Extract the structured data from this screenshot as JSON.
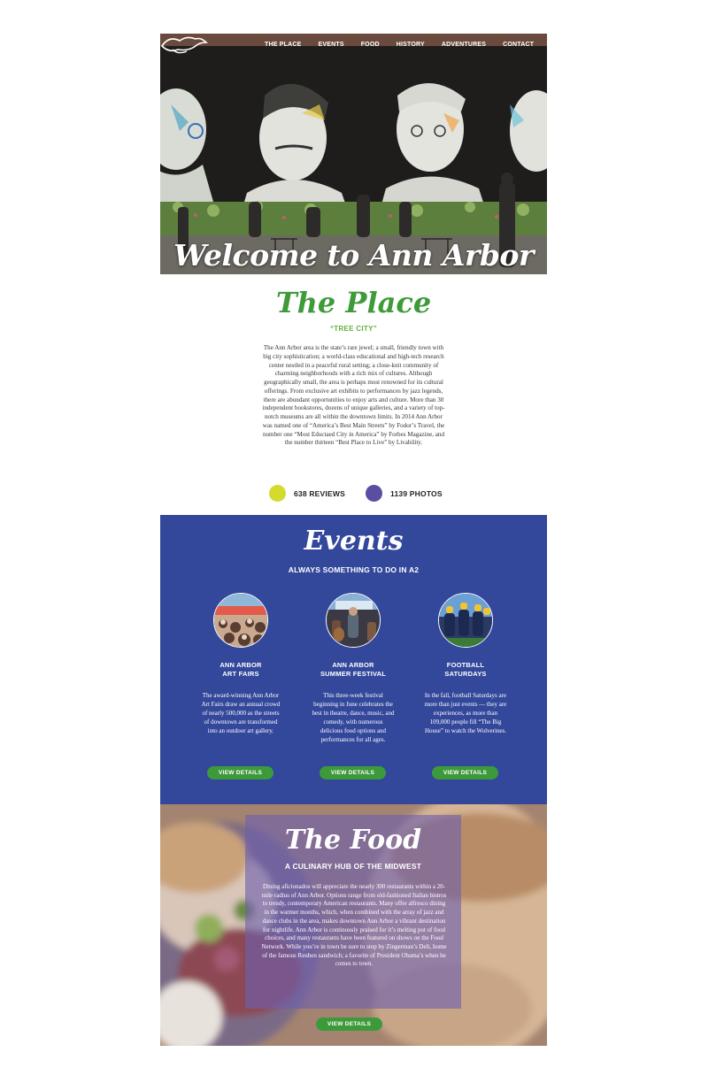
{
  "nav": {
    "items": [
      "THE PLACE",
      "EVENTS",
      "FOOD",
      "HISTORY",
      "ADVENTURES",
      "CONTACT"
    ]
  },
  "hero": {
    "title": "Welcome to Ann Arbor"
  },
  "place": {
    "title": "The Place",
    "subtitle": "“TREE CITY”",
    "body": "The Ann Arbor area is the state’s rare jewel; a small, friendly town with big city sophistication; a world-class educational and high-tech research center nestled in a peaceful rural setting; a close-knit community of charming neighborhoods with a rich mix of cultures. Although geographically small, the area is perhaps most renowned for its cultural offerings. From exclusive art exhibits to performances by jazz legends, there are abundant opportunities to enjoy arts and culture. More than 30 independent bookstores, dozens of unique galleries, and a variety of top-notch museums are all within the downtown limits. In 2014 Ann Arbor was named one of “America’s Best Main Streets” by Fodor’s Travel, the number one “Most Eductaed City in America” by Forbes Magazine, and the number thirteen “Best Place to Live” by Livability.",
    "reviews": "638 REVIEWS",
    "photos": "1139 PHOTOS",
    "reviews_color": "#d3dc2c",
    "photos_color": "#5a4ea3"
  },
  "events": {
    "title": "Events",
    "subtitle": "ALWAYS SOMETHING TO DO IN A2",
    "items": [
      {
        "name_line1": "ANN ARBOR",
        "name_line2": "ART FAIRS",
        "description": "The award-winning Ann Arbor Art Fairs draw an annual crowd of nearly 500,000 as the streets of downtown are transformed into an outdoor art gallery.",
        "button": "VIEW DETAILS"
      },
      {
        "name_line1": "ANN ARBOR",
        "name_line2": "SUMMER FESTIVAL",
        "description": "This three-week festival beginning in June celebrates the best in theatre, dance, music, and comedy, with numerous delicious food options and performances for all ages.",
        "button": "VIEW DETAILS"
      },
      {
        "name_line1": "FOOTBALL",
        "name_line2": "SATURDAYS",
        "description": "In the fall, football Saturdays are more than just events — they are experiences, as more than 109,000 people fill “The Big House” to watch the Wolverines.",
        "button": "VIEW DETAILS"
      }
    ]
  },
  "food": {
    "title": "The Food",
    "subtitle": "A CULINARY HUB OF THE MIDWEST",
    "body": "Dining aficionados will appreciate the nearly 300 restaurants within a 20-mile radius of Ann Arbor. Options range from old-fashioned Italian bistros to trendy, contemporary American restaurants. Many offer alfresco dining in the warmer months, which, when combined with the array of jazz and dance clubs in the area, makes downtown Ann Arbor a vibrant destination for nightlife. Ann Arbor is continously praised for it’s melting pot of food choices, and many restaurants have been featured on shows on the Food Network. While you’re in town be sure to stop by Zingerman’s Deli, home of the famous Reuben sandwich; a favorite of President Obama’s when he comes to town.",
    "button": "VIEW DETAILS"
  },
  "colors": {
    "green": "#3f9b3a",
    "events_bg": "#33479b",
    "food_overlay": "#6e60af"
  }
}
